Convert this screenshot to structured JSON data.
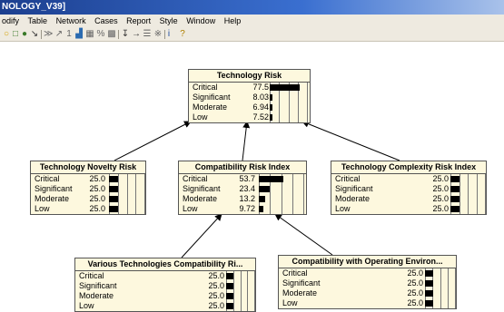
{
  "window": {
    "title": "NOLOGY_V39]"
  },
  "menu": [
    "odify",
    "Table",
    "Network",
    "Cases",
    "Report",
    "Style",
    "Window",
    "Help"
  ],
  "toolbar_icons": [
    {
      "name": "circle-icon",
      "glyph": "○",
      "color": "#d4a000"
    },
    {
      "name": "rectangle-icon",
      "glyph": "□",
      "color": "#3a7a2a"
    },
    {
      "name": "ellipse-icon",
      "glyph": "●",
      "color": "#3a7a2a"
    },
    {
      "name": "select-arrow-icon",
      "glyph": "↘",
      "color": "#333333"
    },
    {
      "name": "compile-icon",
      "glyph": "≫",
      "color": "#666666"
    },
    {
      "name": "absorb-icon",
      "glyph": "↗",
      "color": "#666666"
    },
    {
      "name": "one-icon",
      "glyph": "1",
      "color": "#666666"
    },
    {
      "name": "chart-icon",
      "glyph": "▟",
      "color": "#2a6ab0"
    },
    {
      "name": "table-icon",
      "glyph": "▦",
      "color": "#666666"
    },
    {
      "name": "percent-icon",
      "glyph": "%",
      "color": "#666666"
    },
    {
      "name": "grid-icon",
      "glyph": "▩",
      "color": "#666666"
    },
    {
      "name": "find-icon",
      "glyph": "↧",
      "color": "#333333"
    },
    {
      "name": "arrow-right-icon",
      "glyph": "→",
      "color": "#333333"
    },
    {
      "name": "list-icon",
      "glyph": "☰",
      "color": "#666666"
    },
    {
      "name": "tools-icon",
      "glyph": "※",
      "color": "#666666"
    },
    {
      "name": "info-icon",
      "glyph": "i",
      "color": "#1a4aa0"
    },
    {
      "name": "help-icon",
      "glyph": "?",
      "color": "#b08000"
    }
  ],
  "nodes": [
    {
      "id": "technology-risk",
      "title": "Technology Risk",
      "states": [
        {
          "label": "Critical",
          "value": "77.5",
          "pct": 77.5
        },
        {
          "label": "Significant",
          "value": "8.03",
          "pct": 8.03
        },
        {
          "label": "Moderate",
          "value": "6.94",
          "pct": 6.94
        },
        {
          "label": "Low",
          "value": "7.52",
          "pct": 7.52
        }
      ]
    },
    {
      "id": "technology-novelty-risk",
      "title": "Technology Novelty Risk",
      "states": [
        {
          "label": "Critical",
          "value": "25.0",
          "pct": 25
        },
        {
          "label": "Significant",
          "value": "25.0",
          "pct": 25
        },
        {
          "label": "Moderate",
          "value": "25.0",
          "pct": 25
        },
        {
          "label": "Low",
          "value": "25.0",
          "pct": 25
        }
      ]
    },
    {
      "id": "compatibility-risk-index",
      "title": "Compatibility Risk Index",
      "states": [
        {
          "label": "Critical",
          "value": "53.7",
          "pct": 53.7
        },
        {
          "label": "Significant",
          "value": "23.4",
          "pct": 23.4
        },
        {
          "label": "Moderate",
          "value": "13.2",
          "pct": 13.2
        },
        {
          "label": "Low",
          "value": "9.72",
          "pct": 9.72
        }
      ]
    },
    {
      "id": "technology-complexity-risk-index",
      "title": "Technology Complexity Risk Index",
      "states": [
        {
          "label": "Critical",
          "value": "25.0",
          "pct": 25
        },
        {
          "label": "Significant",
          "value": "25.0",
          "pct": 25
        },
        {
          "label": "Moderate",
          "value": "25.0",
          "pct": 25
        },
        {
          "label": "Low",
          "value": "25.0",
          "pct": 25
        }
      ]
    },
    {
      "id": "various-technologies-compatibility",
      "title": "Various Technologies Compatibility Ri...",
      "states": [
        {
          "label": "Critical",
          "value": "25.0",
          "pct": 25
        },
        {
          "label": "Significant",
          "value": "25.0",
          "pct": 25
        },
        {
          "label": "Moderate",
          "value": "25.0",
          "pct": 25
        },
        {
          "label": "Low",
          "value": "25.0",
          "pct": 25
        }
      ]
    },
    {
      "id": "compatibility-operating-environment",
      "title": "Compatibility with Operating Environ...",
      "states": [
        {
          "label": "Critical",
          "value": "25.0",
          "pct": 25
        },
        {
          "label": "Significant",
          "value": "25.0",
          "pct": 25
        },
        {
          "label": "Moderate",
          "value": "25.0",
          "pct": 25
        },
        {
          "label": "Low",
          "value": "25.0",
          "pct": 25
        }
      ]
    }
  ],
  "edges": [
    {
      "from": "technology-novelty-risk",
      "to": "technology-risk"
    },
    {
      "from": "compatibility-risk-index",
      "to": "technology-risk"
    },
    {
      "from": "technology-complexity-risk-index",
      "to": "technology-risk"
    },
    {
      "from": "various-technologies-compatibility",
      "to": "compatibility-risk-index"
    },
    {
      "from": "compatibility-operating-environment",
      "to": "compatibility-risk-index"
    }
  ]
}
